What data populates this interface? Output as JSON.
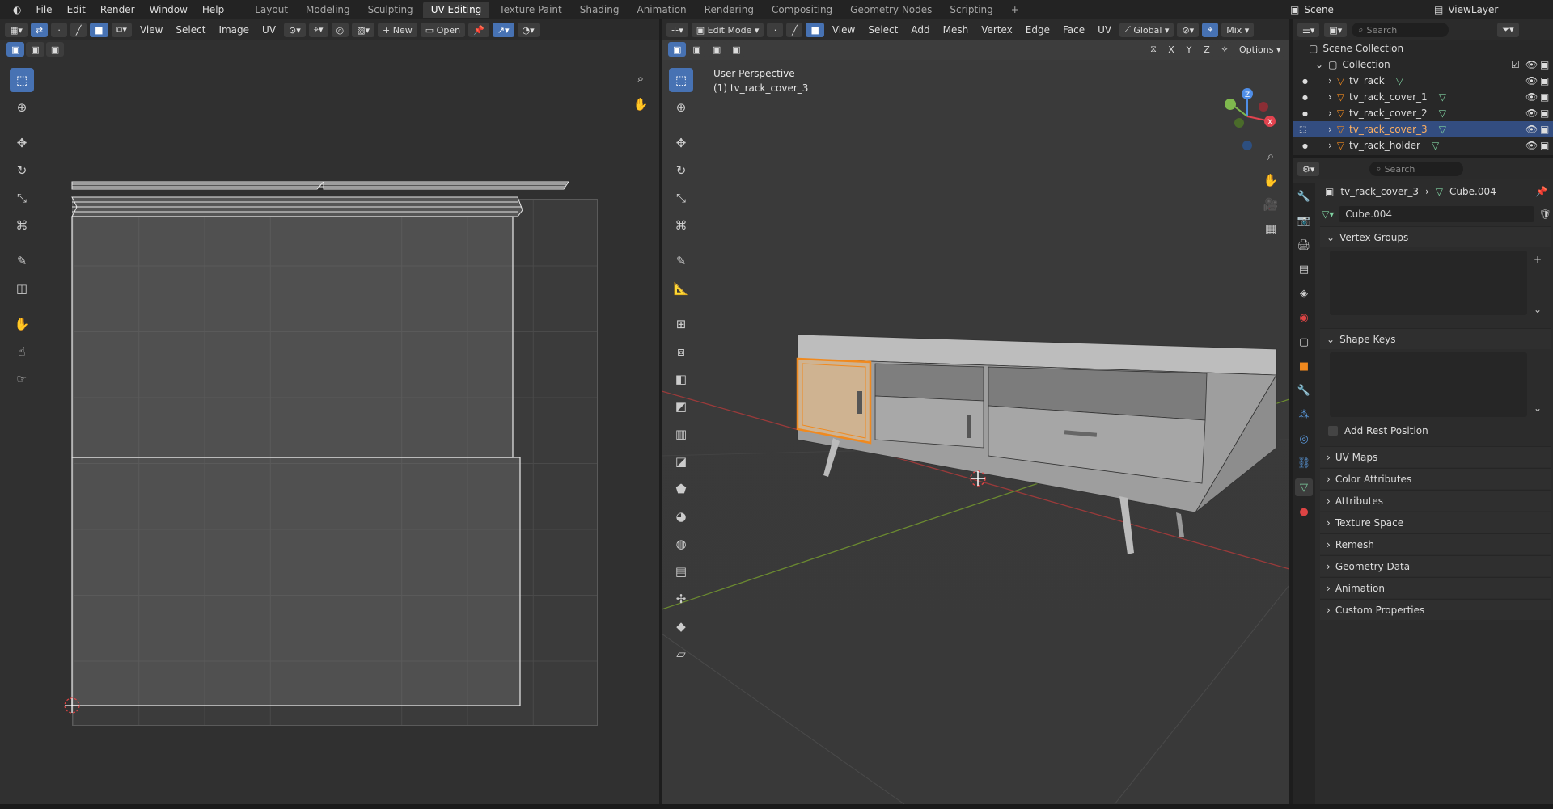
{
  "menu": [
    "File",
    "Edit",
    "Render",
    "Window",
    "Help"
  ],
  "workspaces": [
    "Layout",
    "Modeling",
    "Sculpting",
    "UV Editing",
    "Texture Paint",
    "Shading",
    "Animation",
    "Rendering",
    "Compositing",
    "Geometry Nodes",
    "Scripting"
  ],
  "active_workspace": "UV Editing",
  "scene_label": "Scene",
  "viewlayer_label": "ViewLayer",
  "uv_editor": {
    "menus": [
      "View",
      "Select",
      "Image",
      "UV"
    ],
    "new_label": "New",
    "open_label": "Open"
  },
  "viewport": {
    "mode": "Edit Mode",
    "menus": [
      "View",
      "Select",
      "Add",
      "Mesh",
      "Vertex",
      "Edge",
      "Face",
      "UV"
    ],
    "orientation": "Global",
    "snap_label": "Mix",
    "options_label": "Options",
    "axes": [
      "X",
      "Y",
      "Z"
    ],
    "perspective_text": "User Perspective",
    "object_text": "(1) tv_rack_cover_3"
  },
  "outliner": {
    "search_placeholder": "Search",
    "scene_collection": "Scene Collection",
    "collection": "Collection",
    "items": [
      "tv_rack",
      "tv_rack_cover_1",
      "tv_rack_cover_2",
      "tv_rack_cover_3",
      "tv_rack_holder"
    ],
    "selected": "tv_rack_cover_3"
  },
  "properties": {
    "search_placeholder": "Search",
    "breadcrumb_object": "tv_rack_cover_3",
    "breadcrumb_mesh": "Cube.004",
    "mesh_name": "Cube.004",
    "panels": {
      "vertex_groups": "Vertex Groups",
      "shape_keys": "Shape Keys",
      "add_rest_position": "Add Rest Position",
      "uv_maps": "UV Maps",
      "color_attributes": "Color Attributes",
      "attributes": "Attributes",
      "texture_space": "Texture Space",
      "remesh": "Remesh",
      "geometry_data": "Geometry Data",
      "animation": "Animation",
      "custom_properties": "Custom Properties"
    }
  },
  "colors": {
    "accent": "#4772b3",
    "selection_orange": "#f0891e",
    "x_axis": "#e2434f",
    "y_axis": "#7fb84e",
    "z_axis": "#4f8ee8"
  }
}
